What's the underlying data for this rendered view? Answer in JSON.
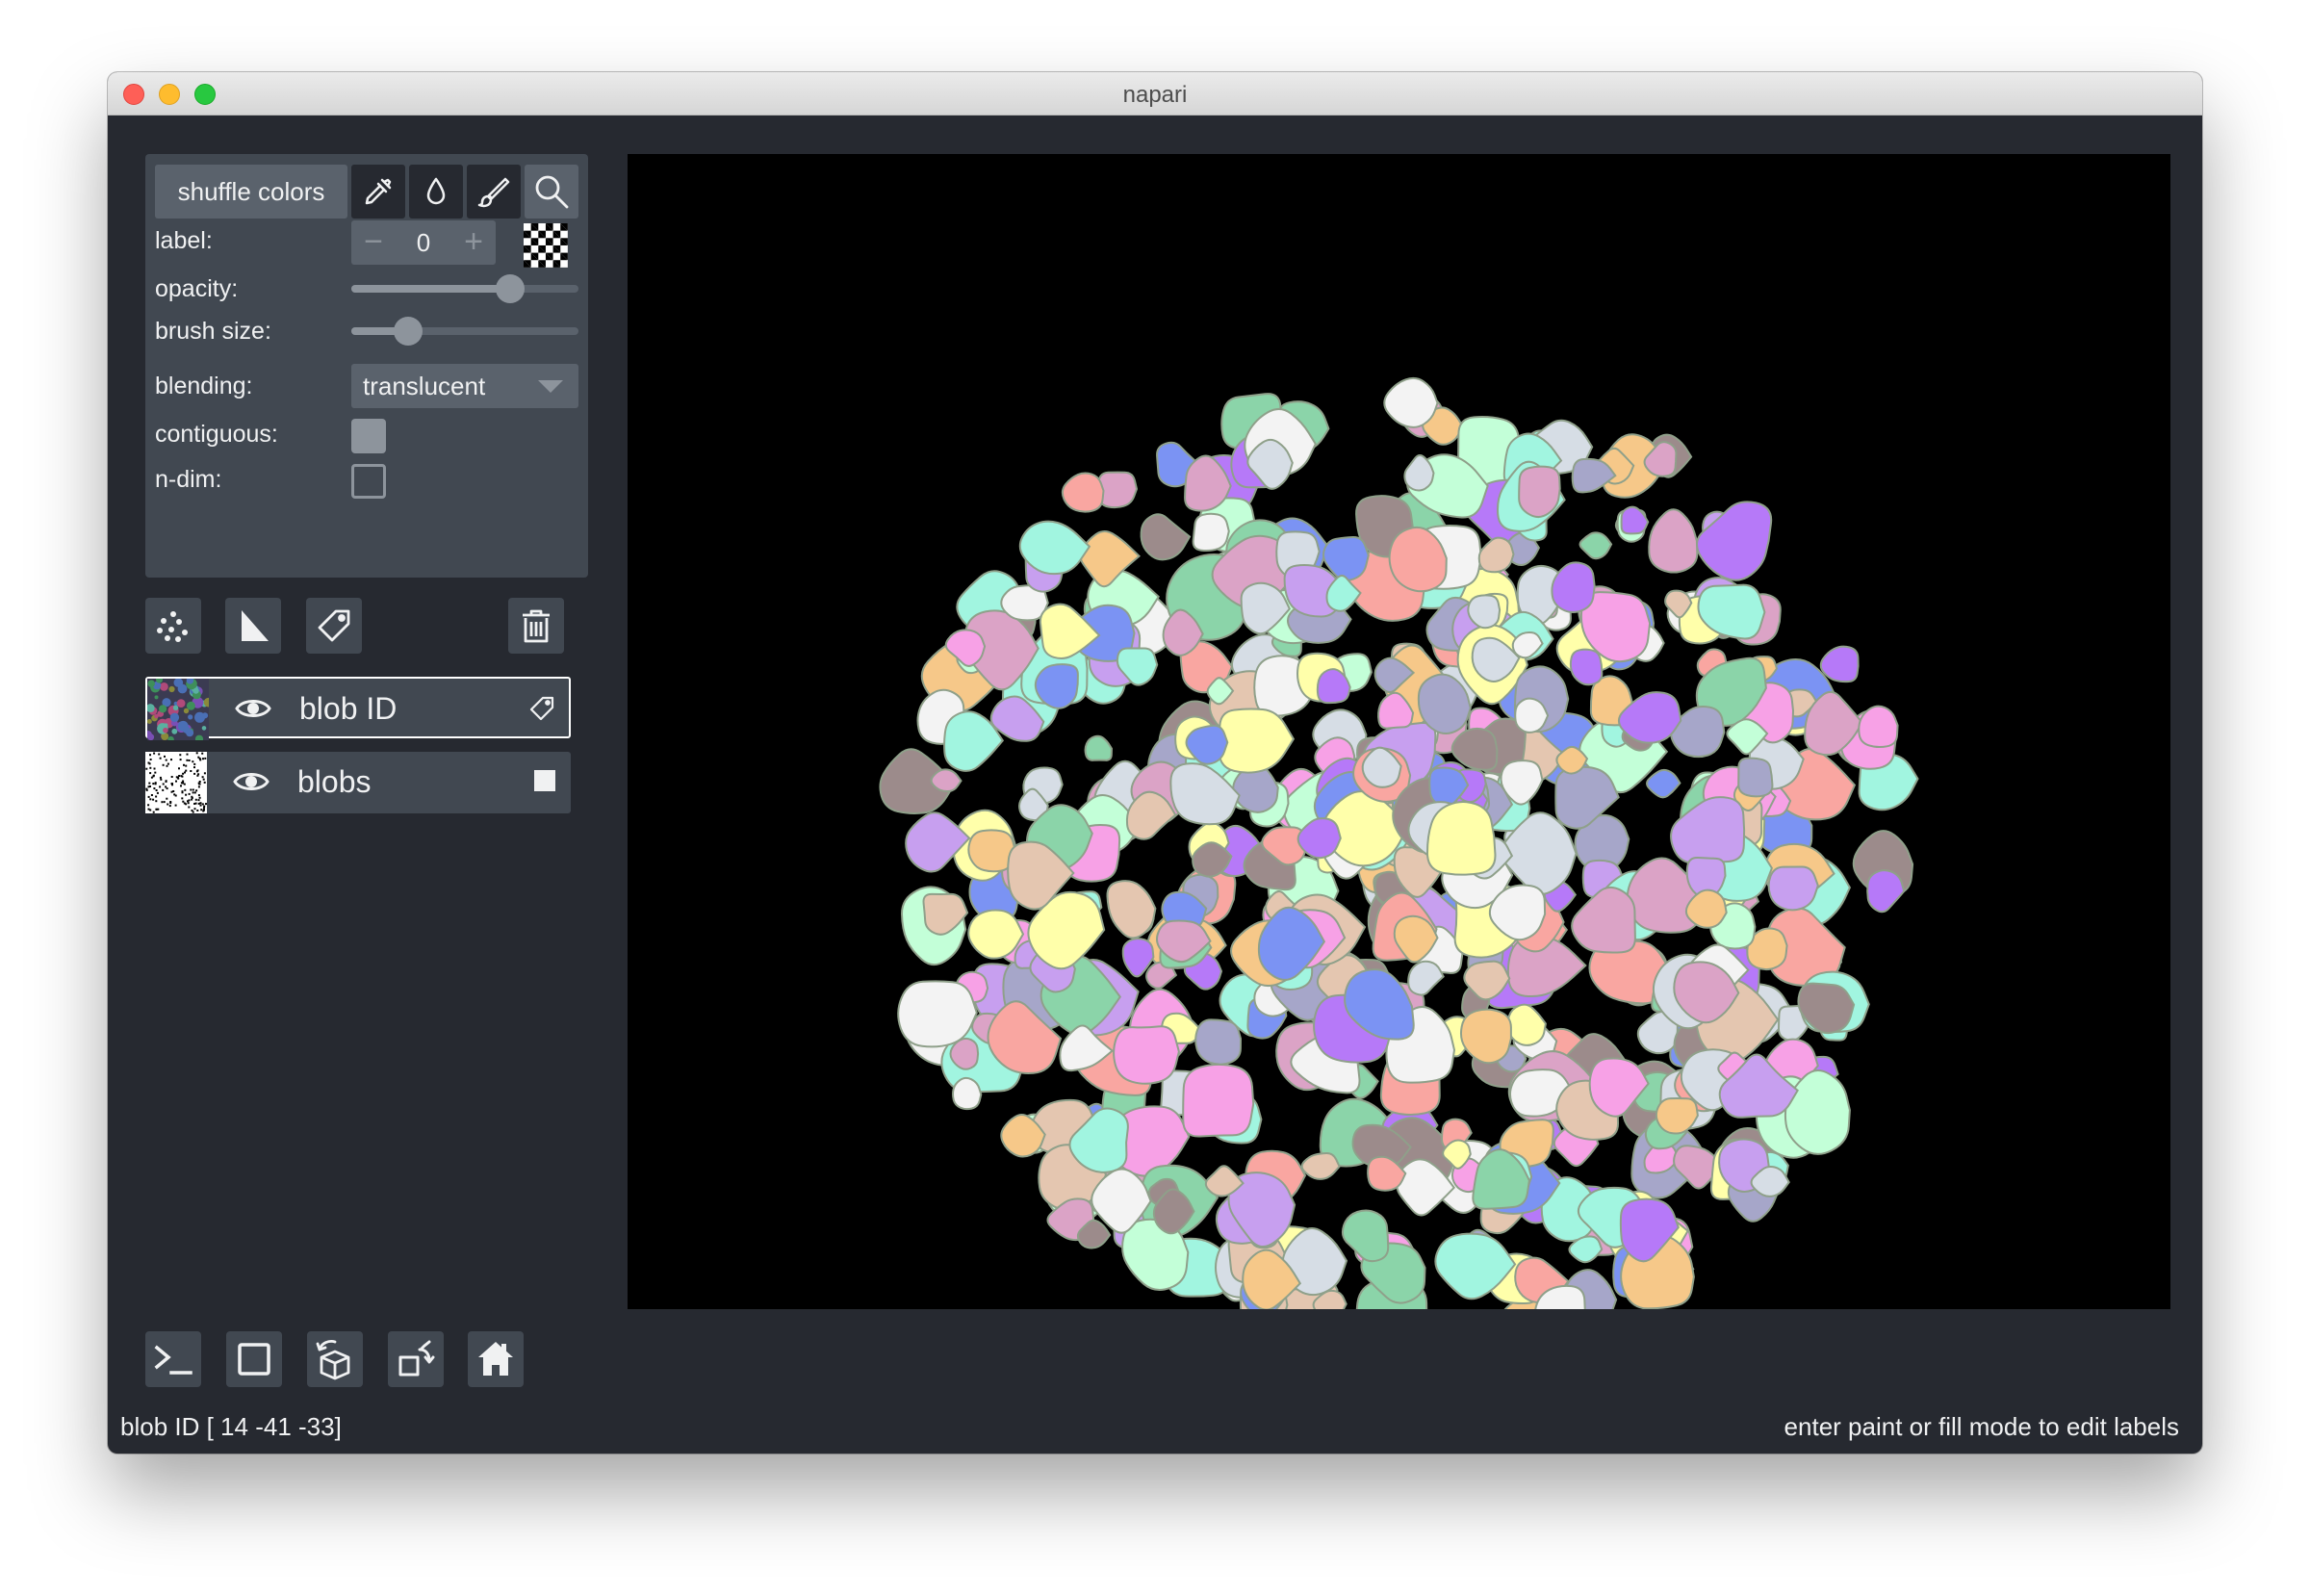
{
  "window": {
    "title": "napari"
  },
  "controls": {
    "shuffle_label": "shuffle colors",
    "tools": [
      "picker-icon",
      "fill-icon",
      "paint-icon",
      "zoom-icon"
    ],
    "active_tool": "zoom-icon",
    "label_label": "label:",
    "label_value": "0",
    "opacity_label": "opacity:",
    "opacity_value": 0.7,
    "brush_size_label": "brush size:",
    "brush_size_value": 0.25,
    "blending_label": "blending:",
    "blending_value": "translucent",
    "contiguous_label": "contiguous:",
    "contiguous_checked": true,
    "ndim_label": "n-dim:",
    "ndim_checked": false
  },
  "layer_buttons": [
    "new-points-icon",
    "new-shapes-icon",
    "new-labels-icon",
    "delete-icon"
  ],
  "layers": [
    {
      "name": "blob ID",
      "visible": true,
      "selected": true,
      "type_icon": "label-tag-icon"
    },
    {
      "name": "blobs",
      "visible": true,
      "selected": false,
      "type_icon": "image-square-icon"
    }
  ],
  "bottom_buttons": [
    "console-icon",
    "2d-3d-toggle-icon",
    "roll-dims-icon",
    "transpose-icon",
    "home-icon"
  ],
  "status": {
    "left": "blob ID [ 14 -41 -33]",
    "right": "enter paint or fill mode to edit labels"
  },
  "palette": [
    "#f7a1e6",
    "#a1f5e0",
    "#c79fef",
    "#ffffaa",
    "#e4c6b0",
    "#d6dde5",
    "#a6a6c9",
    "#f9a6a1",
    "#8bd4a9",
    "#f6c889",
    "#7b93f3",
    "#c3ffd8",
    "#b679f8",
    "#dba3c6",
    "#9c8b8b",
    "#f3f3f3"
  ],
  "accent": "#f0f1f2"
}
